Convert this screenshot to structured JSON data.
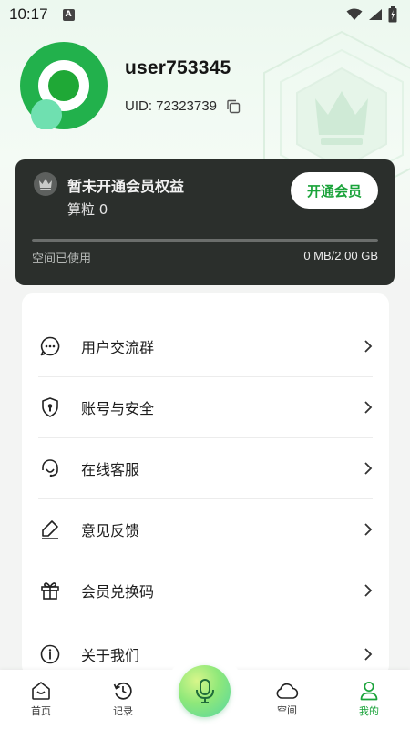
{
  "status_bar": {
    "time": "10:17",
    "notification_badge": "A"
  },
  "profile": {
    "username": "user753345",
    "uid_text": "UID: 72323739",
    "avatar_colors": {
      "outer": "#22b14c",
      "inner": "#ffffff",
      "core": "#1fa836",
      "accent": "#6fe0b0"
    }
  },
  "member_card": {
    "title": "暂未开通会员权益",
    "points": "算粒 0",
    "open_button": "开通会员",
    "storage_label": "空间已使用",
    "storage_value": "0 MB/2.00 GB",
    "storage_used_fraction": 0
  },
  "menu": {
    "items": [
      {
        "label": "用户交流群",
        "icon": "chat-bubble-icon"
      },
      {
        "label": "账号与安全",
        "icon": "shield-lock-icon"
      },
      {
        "label": "在线客服",
        "icon": "headset-icon"
      },
      {
        "label": "意见反馈",
        "icon": "pencil-eraser-icon"
      },
      {
        "label": "会员兑换码",
        "icon": "gift-icon"
      },
      {
        "label": "关于我们",
        "icon": "info-icon"
      }
    ]
  },
  "bottom_nav": {
    "items": [
      {
        "label": "首页",
        "icon": "home-icon",
        "active": false
      },
      {
        "label": "记录",
        "icon": "history-icon",
        "active": false
      },
      {
        "label": "空间",
        "icon": "cloud-icon",
        "active": false
      },
      {
        "label": "我的",
        "icon": "user-icon",
        "active": true
      }
    ],
    "center_icon": "microphone-icon"
  },
  "colors": {
    "accent": "#1aa33a",
    "card_bg": "#2b2f2c",
    "page_bg": "#f3f4f3"
  }
}
